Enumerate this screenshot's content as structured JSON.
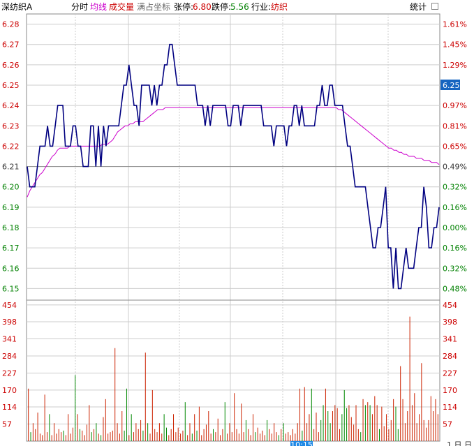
{
  "header": {
    "stock_name": "深纺织A",
    "tab_minute": "分时",
    "tab_avg_line": "均线",
    "tab_volume": "成交量",
    "fill_coord": "满占坐标",
    "limit_up_label": "张停:",
    "limit_up_value": "6.80",
    "limit_down_label": "跌停:",
    "limit_down_value": "5.56",
    "industry_label": "行业:",
    "industry_value": "纺织",
    "stats_button": "统计"
  },
  "price_axis": {
    "left_ticks": [
      "6.28",
      "6.27",
      "6.26",
      "6.25",
      "6.24",
      "6.23",
      "6.22",
      "6.21",
      "6.20",
      "6.19",
      "6.18",
      "6.17",
      "6.16",
      "6.15"
    ],
    "right_ticks": [
      "1.61%",
      "1.45%",
      "1.29%",
      "",
      "0.97%",
      "0.81%",
      "0.65%",
      "0.49%",
      "0.32%",
      "0.16%",
      "0.00%",
      "0.16%",
      "0.32%",
      "0.48%"
    ],
    "current_price": "6.25"
  },
  "volume_axis": {
    "ticks": [
      "454",
      "398",
      "341",
      "284",
      "227",
      "170",
      "114",
      "57"
    ]
  },
  "bottom_labels": {
    "time_box": "10:15",
    "right_corner": "1 日 日"
  },
  "colors": {
    "price_line": "#000080",
    "avg_line": "#cc00cc",
    "vol_up": "#cc2200",
    "vol_down": "#008800",
    "grid": "#cccccc",
    "red_text": "#cc0000",
    "green_text": "#008000"
  },
  "chart_data": {
    "type": "line",
    "ylim": [
      6.145,
      6.285
    ],
    "volume_ylim": [
      0,
      470
    ],
    "price": [
      6.21,
      6.2,
      6.2,
      6.2,
      6.21,
      6.22,
      6.22,
      6.22,
      6.23,
      6.22,
      6.22,
      6.23,
      6.24,
      6.24,
      6.24,
      6.22,
      6.22,
      6.22,
      6.23,
      6.23,
      6.22,
      6.22,
      6.21,
      6.21,
      6.21,
      6.23,
      6.23,
      6.21,
      6.23,
      6.21,
      6.23,
      6.22,
      6.23,
      6.23,
      6.23,
      6.23,
      6.23,
      6.24,
      6.25,
      6.25,
      6.26,
      6.25,
      6.24,
      6.24,
      6.23,
      6.25,
      6.25,
      6.25,
      6.25,
      6.24,
      6.25,
      6.24,
      6.25,
      6.25,
      6.26,
      6.26,
      6.27,
      6.27,
      6.26,
      6.25,
      6.25,
      6.25,
      6.25,
      6.25,
      6.25,
      6.25,
      6.25,
      6.24,
      6.24,
      6.24,
      6.23,
      6.24,
      6.23,
      6.24,
      6.24,
      6.24,
      6.24,
      6.24,
      6.24,
      6.23,
      6.23,
      6.24,
      6.24,
      6.24,
      6.23,
      6.24,
      6.24,
      6.24,
      6.24,
      6.24,
      6.24,
      6.24,
      6.24,
      6.23,
      6.23,
      6.23,
      6.23,
      6.22,
      6.23,
      6.23,
      6.23,
      6.23,
      6.22,
      6.23,
      6.23,
      6.24,
      6.24,
      6.23,
      6.24,
      6.23,
      6.23,
      6.23,
      6.23,
      6.23,
      6.24,
      6.24,
      6.25,
      6.24,
      6.24,
      6.25,
      6.25,
      6.24,
      6.24,
      6.24,
      6.24,
      6.23,
      6.22,
      6.22,
      6.21,
      6.2,
      6.2,
      6.2,
      6.2,
      6.2,
      6.19,
      6.18,
      6.17,
      6.17,
      6.18,
      6.18,
      6.19,
      6.2,
      6.17,
      6.17,
      6.15,
      6.17,
      6.15,
      6.15,
      6.16,
      6.17,
      6.16,
      6.16,
      6.16,
      6.17,
      6.18,
      6.18,
      6.2,
      6.19,
      6.17,
      6.17,
      6.18,
      6.18,
      6.19
    ],
    "avg": [
      6.195,
      6.198,
      6.2,
      6.202,
      6.204,
      6.206,
      6.207,
      6.209,
      6.211,
      6.213,
      6.215,
      6.216,
      6.218,
      6.219,
      6.219,
      6.219,
      6.219,
      6.22,
      6.22,
      6.22,
      6.22,
      6.22,
      6.22,
      6.22,
      6.22,
      6.22,
      6.22,
      6.22,
      6.22,
      6.22,
      6.221,
      6.221,
      6.221,
      6.222,
      6.223,
      6.225,
      6.227,
      6.228,
      6.229,
      6.23,
      6.23,
      6.231,
      6.231,
      6.232,
      6.232,
      6.232,
      6.232,
      6.233,
      6.234,
      6.235,
      6.236,
      6.237,
      6.238,
      6.238,
      6.238,
      6.239,
      6.239,
      6.239,
      6.239,
      6.239,
      6.239,
      6.239,
      6.239,
      6.239,
      6.239,
      6.239,
      6.239,
      6.239,
      6.239,
      6.239,
      6.239,
      6.239,
      6.239,
      6.239,
      6.239,
      6.239,
      6.239,
      6.239,
      6.239,
      6.239,
      6.239,
      6.239,
      6.239,
      6.239,
      6.239,
      6.239,
      6.239,
      6.239,
      6.239,
      6.239,
      6.239,
      6.239,
      6.239,
      6.239,
      6.239,
      6.239,
      6.239,
      6.239,
      6.239,
      6.239,
      6.239,
      6.239,
      6.239,
      6.239,
      6.239,
      6.239,
      6.239,
      6.239,
      6.239,
      6.239,
      6.239,
      6.239,
      6.239,
      6.239,
      6.239,
      6.239,
      6.239,
      6.239,
      6.239,
      6.239,
      6.239,
      6.239,
      6.239,
      6.239,
      6.238,
      6.238,
      6.237,
      6.236,
      6.235,
      6.234,
      6.233,
      6.232,
      6.231,
      6.23,
      6.229,
      6.228,
      6.227,
      6.226,
      6.225,
      6.224,
      6.223,
      6.222,
      6.221,
      6.22,
      6.219,
      6.219,
      6.218,
      6.218,
      6.217,
      6.217,
      6.216,
      6.216,
      6.215,
      6.215,
      6.215,
      6.214,
      6.214,
      6.214,
      6.213,
      6.213,
      6.213,
      6.212,
      6.212,
      6.212,
      6.211
    ],
    "volume": [
      175,
      30,
      60,
      40,
      95,
      25,
      20,
      155,
      30,
      90,
      20,
      60,
      25,
      40,
      30,
      35,
      20,
      90,
      25,
      45,
      220,
      90,
      40,
      35,
      20,
      55,
      120,
      30,
      40,
      60,
      25,
      20,
      80,
      140,
      25,
      30,
      35,
      310,
      60,
      25,
      100,
      35,
      175,
      20,
      90,
      30,
      60,
      40,
      70,
      35,
      295,
      60,
      25,
      170,
      40,
      30,
      60,
      25,
      90,
      45,
      20,
      40,
      90,
      30,
      45,
      25,
      35,
      130,
      20,
      60,
      25,
      90,
      35,
      115,
      20,
      40,
      55,
      100,
      25,
      40,
      30,
      75,
      20,
      40,
      130,
      25,
      60,
      30,
      160,
      40,
      25,
      125,
      30,
      70,
      40,
      20,
      90,
      30,
      45,
      25,
      35,
      20,
      70,
      40,
      25,
      60,
      30,
      20,
      40,
      60,
      25,
      30,
      20,
      40,
      25,
      60,
      175,
      35,
      180,
      60,
      90,
      175,
      40,
      95,
      30,
      70,
      120,
      175,
      100,
      60,
      100,
      120,
      110,
      40,
      90,
      170,
      110,
      120,
      80,
      55,
      120,
      40,
      30,
      140,
      120,
      130,
      120,
      90,
      150,
      120,
      40,
      115,
      50,
      90,
      40,
      70,
      140,
      115,
      40,
      250,
      140,
      60,
      100,
      415,
      120,
      160,
      60,
      90,
      260,
      70,
      45,
      70,
      150,
      100,
      140,
      90
    ]
  }
}
